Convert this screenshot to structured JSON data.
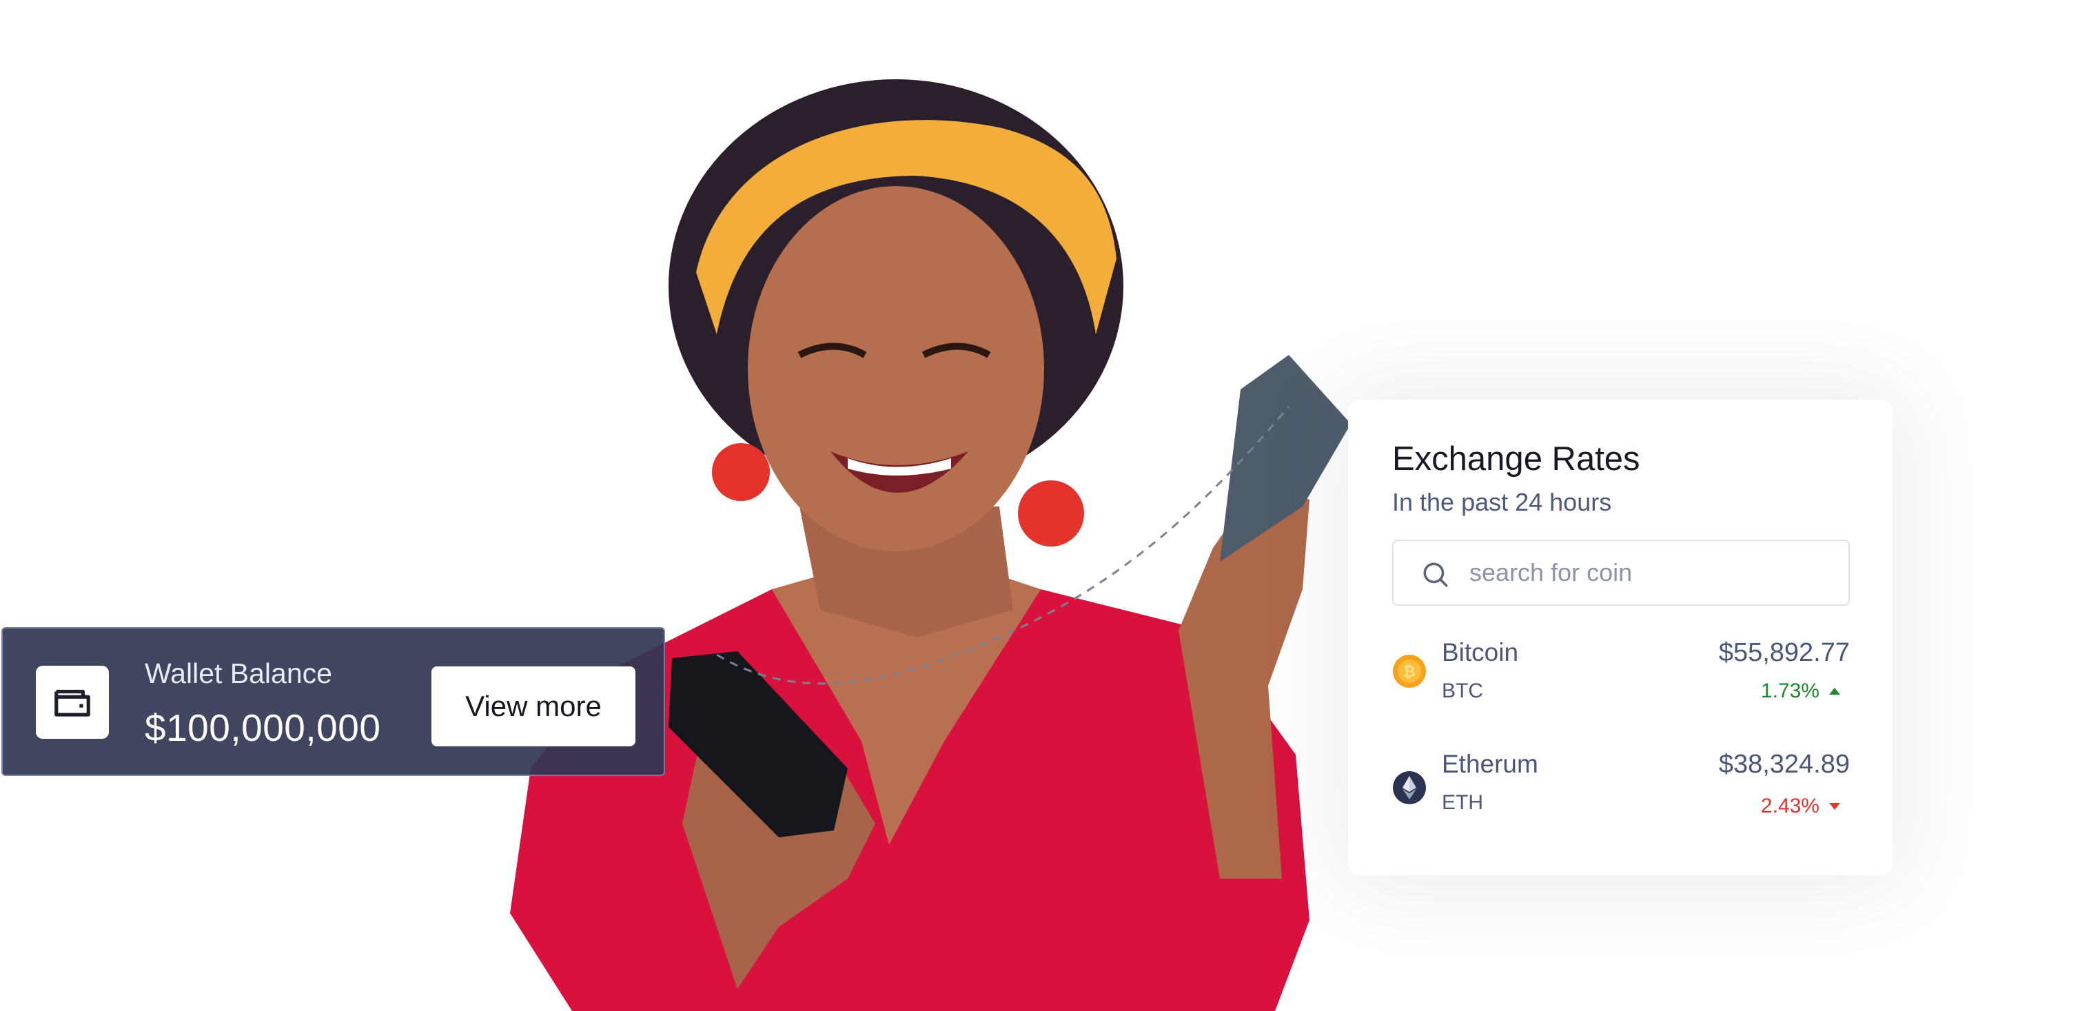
{
  "wallet": {
    "label": "Wallet Balance",
    "amount": "$100,000,000",
    "button_label": "View more",
    "icon": "wallet-icon"
  },
  "exchange": {
    "title": "Exchange Rates",
    "subtitle": "In the past 24 hours",
    "search": {
      "placeholder": "search for coin",
      "value": "",
      "icon": "search-icon"
    },
    "coins": [
      {
        "name": "Bitcoin",
        "symbol": "BTC",
        "price": "$55,892.77",
        "change": "1.73%",
        "direction": "up",
        "icon": "bitcoin-icon",
        "color": "#f7a21b"
      },
      {
        "name": "Etherum",
        "symbol": "ETH",
        "price": "$38,324.89",
        "change": "2.43%",
        "direction": "down",
        "icon": "ethereum-icon",
        "color": "#2c3352"
      }
    ]
  },
  "colors": {
    "wallet_background": "#313652",
    "positive": "#1e8a2e",
    "negative": "#e1342e",
    "text_secondary": "#4a5578"
  }
}
